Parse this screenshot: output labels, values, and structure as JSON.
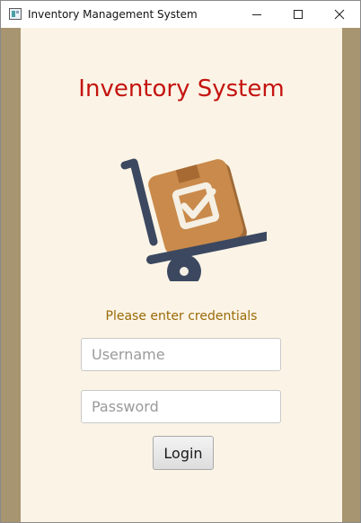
{
  "window": {
    "title": "Inventory Management System",
    "controls": {
      "minimize": "minimize-icon",
      "maximize": "maximize-icon",
      "close": "close-icon"
    }
  },
  "main": {
    "heading": "Inventory System",
    "illustration": "hand-truck-with-box-icon",
    "prompt": "Please enter credentials",
    "username": {
      "placeholder": "Username",
      "value": ""
    },
    "password": {
      "placeholder": "Password",
      "value": ""
    },
    "login_label": "Login"
  },
  "colors": {
    "background_frame": "#a79470",
    "panel": "#fbf4e6",
    "heading": "#c41410",
    "prompt": "#9a6a08",
    "box": "#c98a4b",
    "dolly": "#3c4860"
  }
}
